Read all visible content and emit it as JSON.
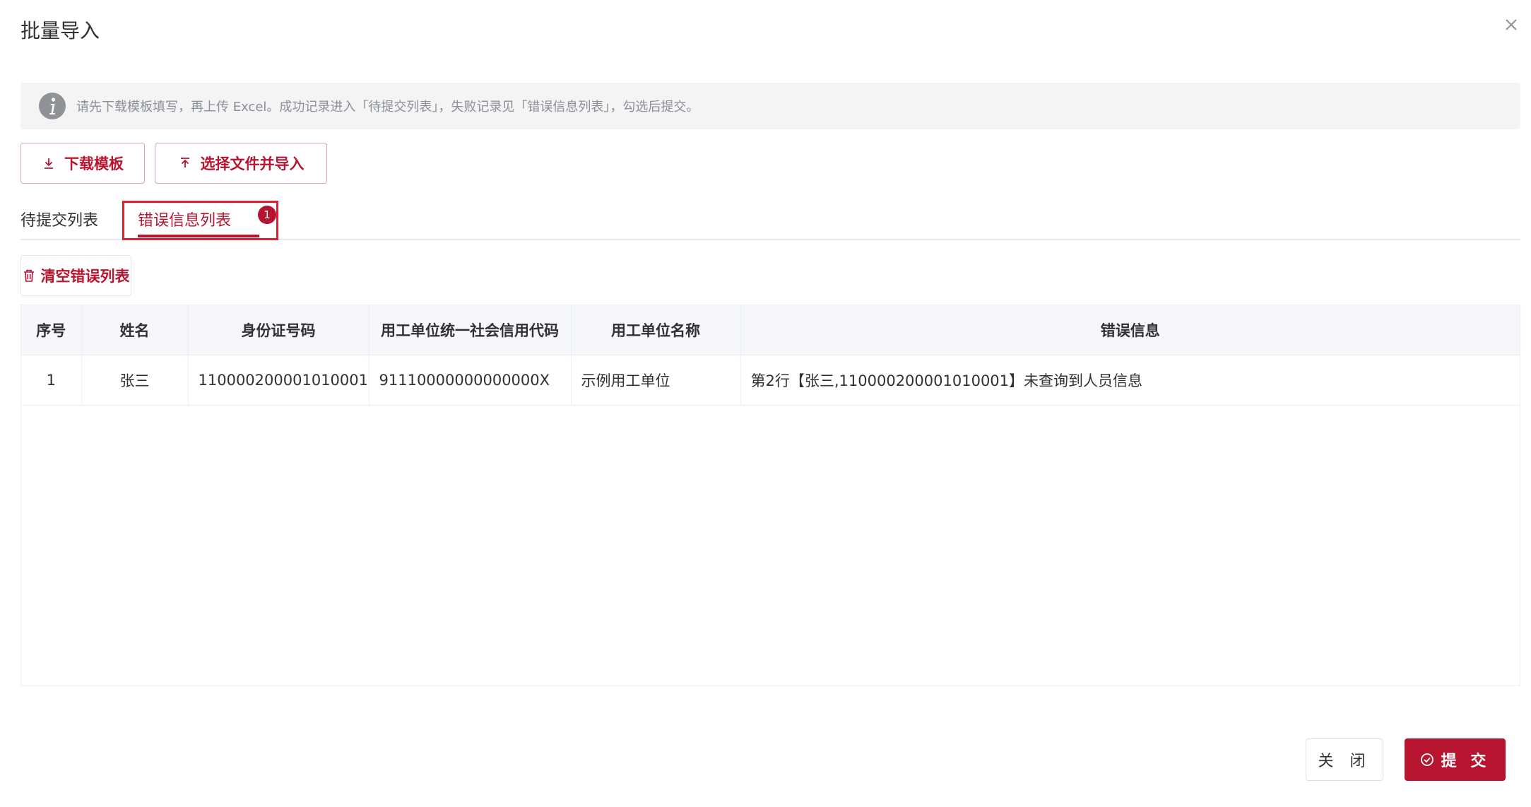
{
  "dialog": {
    "title": "批量导入"
  },
  "alert": {
    "text": "请先下载模板填写，再上传 Excel。成功记录进入「待提交列表」，失败记录见「错误信息列表」，勾选后提交。"
  },
  "toolbar": {
    "download_label": "下载模板",
    "import_label": "选择文件并导入"
  },
  "tabs": [
    {
      "label": "待提交列表"
    },
    {
      "label": "错误信息列表",
      "badge": "1"
    }
  ],
  "clear_label": "清空错误列表",
  "table": {
    "headers": [
      "序号",
      "姓名",
      "身份证号码",
      "用工单位统一社会信用代码",
      "用工单位名称",
      "错误信息"
    ],
    "rows": [
      [
        "1",
        "张三",
        "110000200001010001",
        "91110000000000000X",
        "示例用工单位",
        "第2行【张三,110000200001010001】未查询到人员信息"
      ]
    ]
  },
  "footer": {
    "close_label": "关 闭",
    "submit_label": "提 交"
  },
  "colors": {
    "accent": "#b7152f",
    "highlight": "#e01f2f"
  }
}
